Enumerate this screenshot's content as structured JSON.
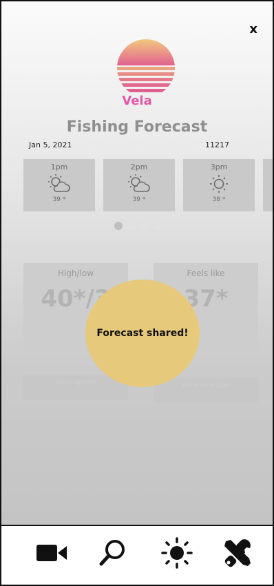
{
  "close_label": "x",
  "brand": "Vela",
  "title": "Fishing Forecast",
  "date": "Jan 5, 2021",
  "zip": "11217",
  "hours": [
    {
      "time": "1pm",
      "icon": "partly-cloudy-icon",
      "temp": "39 *"
    },
    {
      "time": "2pm",
      "icon": "partly-cloudy-icon",
      "temp": "39 *"
    },
    {
      "time": "3pm",
      "icon": "sun-icon",
      "temp": "38 *"
    }
  ],
  "stats": {
    "highlow": {
      "label": "High/low",
      "value": "40*/3"
    },
    "feels": {
      "label": "Feels like",
      "value": "37*"
    },
    "wind_speed": {
      "label": "Wind speed"
    },
    "wind_direction": {
      "label": "Wind direction"
    }
  },
  "toast": "Forecast shared!",
  "nav": [
    {
      "icon": "video-camera-icon"
    },
    {
      "icon": "search-icon"
    },
    {
      "icon": "sun-icon"
    },
    {
      "icon": "tools-icon"
    }
  ],
  "colors": {
    "brand": "#e05aa6",
    "toast": "#e6c97a",
    "logo_top": "#f2c97f",
    "logo_bottom": "#e1608f"
  }
}
